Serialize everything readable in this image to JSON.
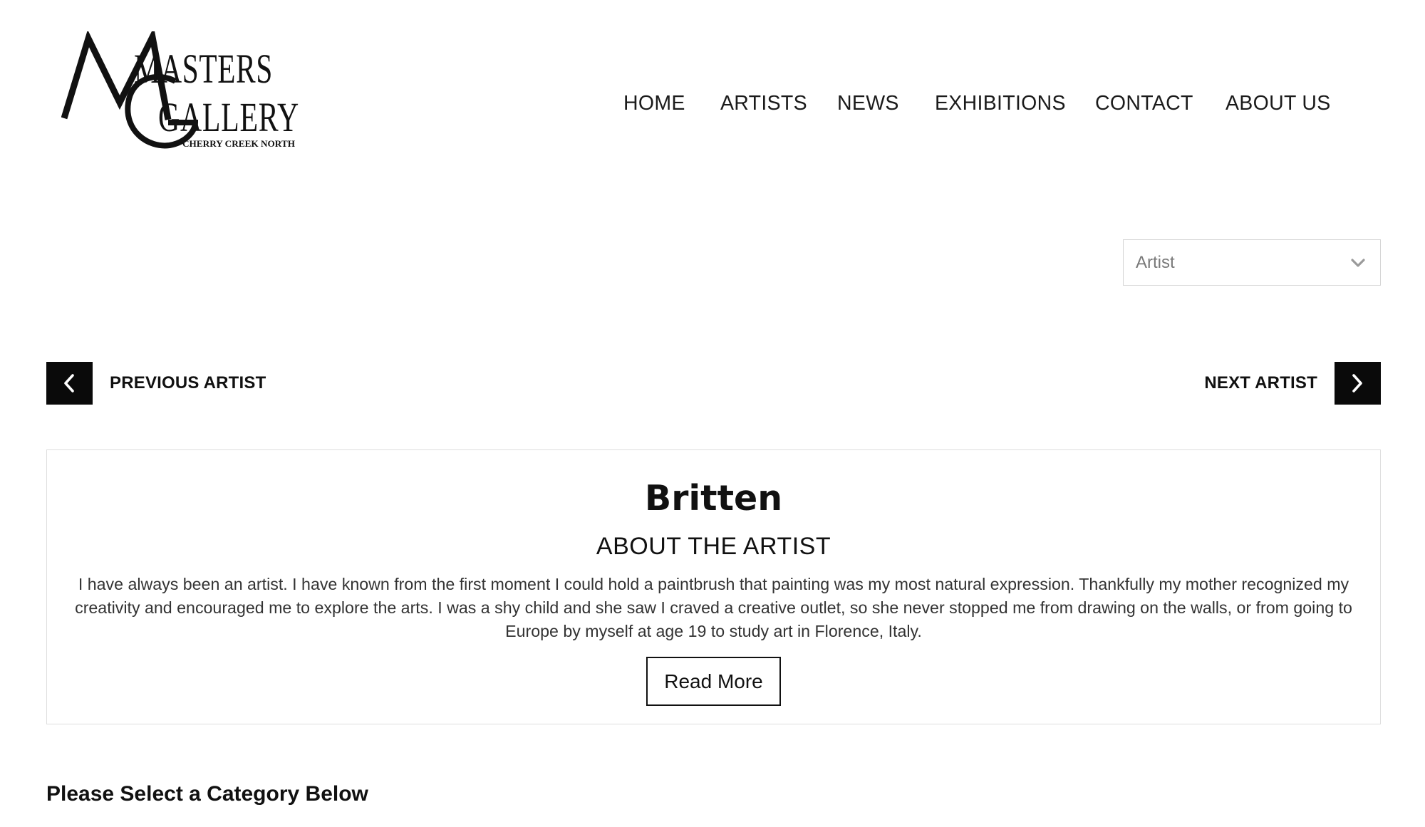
{
  "logo": {
    "line1": "MASTERS",
    "line2": "GALLERY",
    "tagline": "CHERRY CREEK NORTH"
  },
  "nav": {
    "items": [
      {
        "label": "HOME"
      },
      {
        "label": "ARTISTS"
      },
      {
        "label": "NEWS"
      },
      {
        "label": "EXHIBITIONS"
      },
      {
        "label": "CONTACT"
      },
      {
        "label": "ABOUT US"
      }
    ]
  },
  "artist_select": {
    "selected": "Artist",
    "icon": "chevron-down-icon"
  },
  "pager": {
    "previous_label": "PREVIOUS ARTIST",
    "next_label": "NEXT ARTIST",
    "previous_icon": "chevron-left-icon",
    "next_icon": "chevron-right-icon"
  },
  "artist": {
    "name": "Britten",
    "about_heading": "ABOUT THE ARTIST",
    "about_text": "I have always been an artist. I have known from the first moment I could hold a paintbrush that painting was my most natural expression. Thankfully my mother recognized my creativity and encouraged me to explore the arts. I was a shy child and she saw I craved a creative outlet, so she never stopped me from drawing on the walls, or from going to Europe by myself at age 19 to study art in Florence, Italy.",
    "read_more_label": "Read More"
  },
  "category": {
    "heading": "Please Select a Category Below"
  }
}
